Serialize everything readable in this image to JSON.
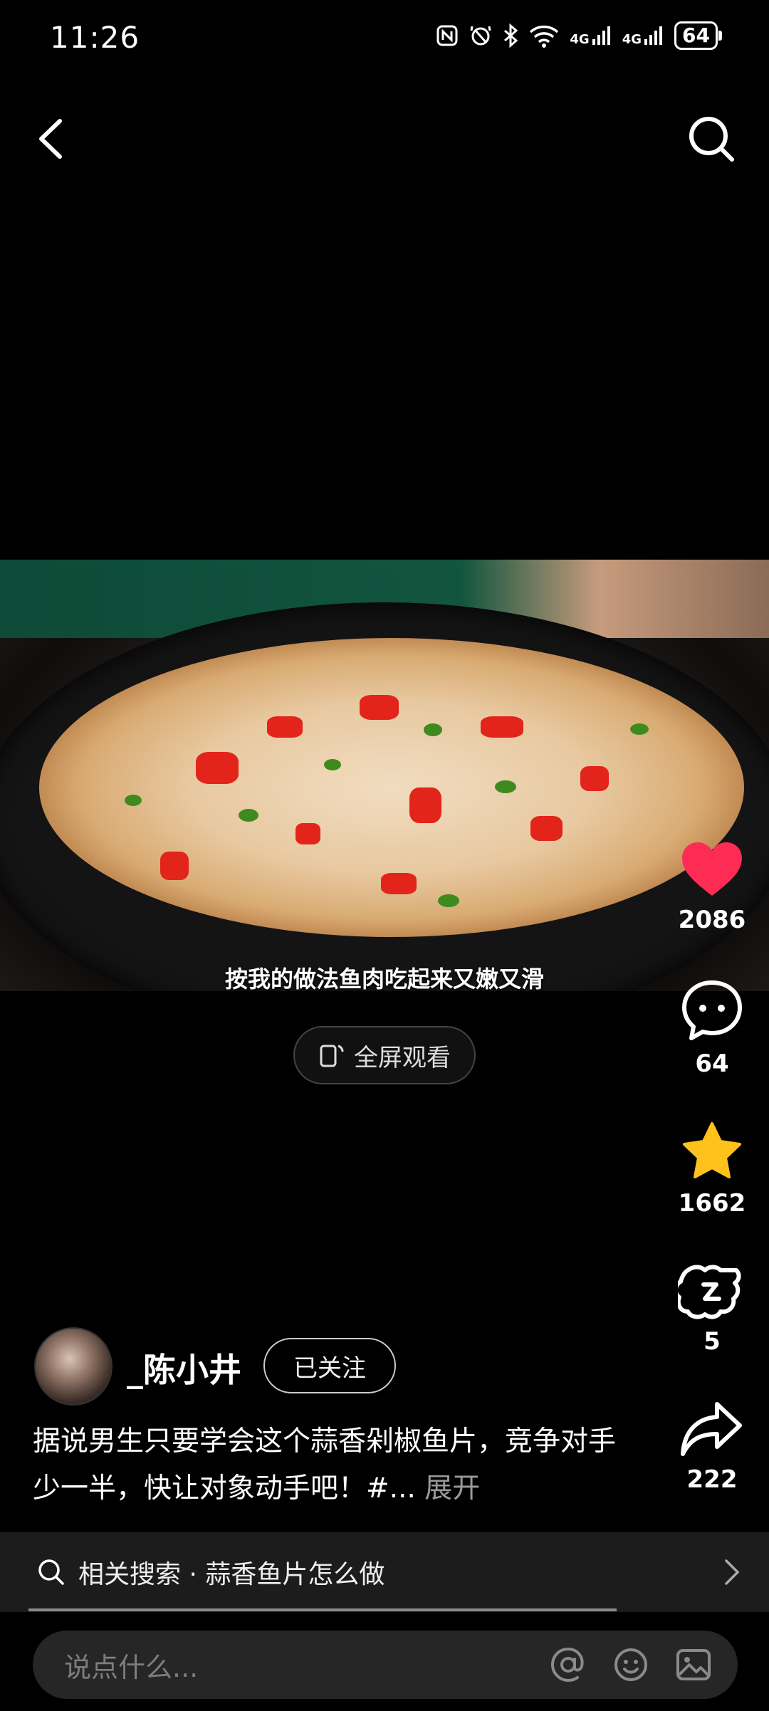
{
  "status_bar": {
    "time": "11:26",
    "network_1": "4G",
    "network_2": "4G",
    "battery": "64"
  },
  "nav": {
    "back_icon": "chevron-left-icon",
    "search_icon": "search-icon"
  },
  "video": {
    "caption": "按我的做法鱼肉吃起来又嫩又滑",
    "fullscreen_label": "全屏观看"
  },
  "actions": {
    "like_count": "2086",
    "comment_count": "64",
    "favorite_count": "1662",
    "share_friends_count": "5",
    "share_count": "222",
    "like_color": "#fe2c55",
    "favorite_color": "#ffc11c"
  },
  "author": {
    "name": "_陈小井",
    "follow_label": "已关注"
  },
  "description": {
    "text": "据说男生只要学会这个蒜香剁椒鱼片，竞争对手少一半，快让对象动手吧！#...",
    "more_label": "展开"
  },
  "related_search": {
    "text": "相关搜索 · 蒜香鱼片怎么做"
  },
  "comment_input": {
    "placeholder": "说点什么..."
  }
}
